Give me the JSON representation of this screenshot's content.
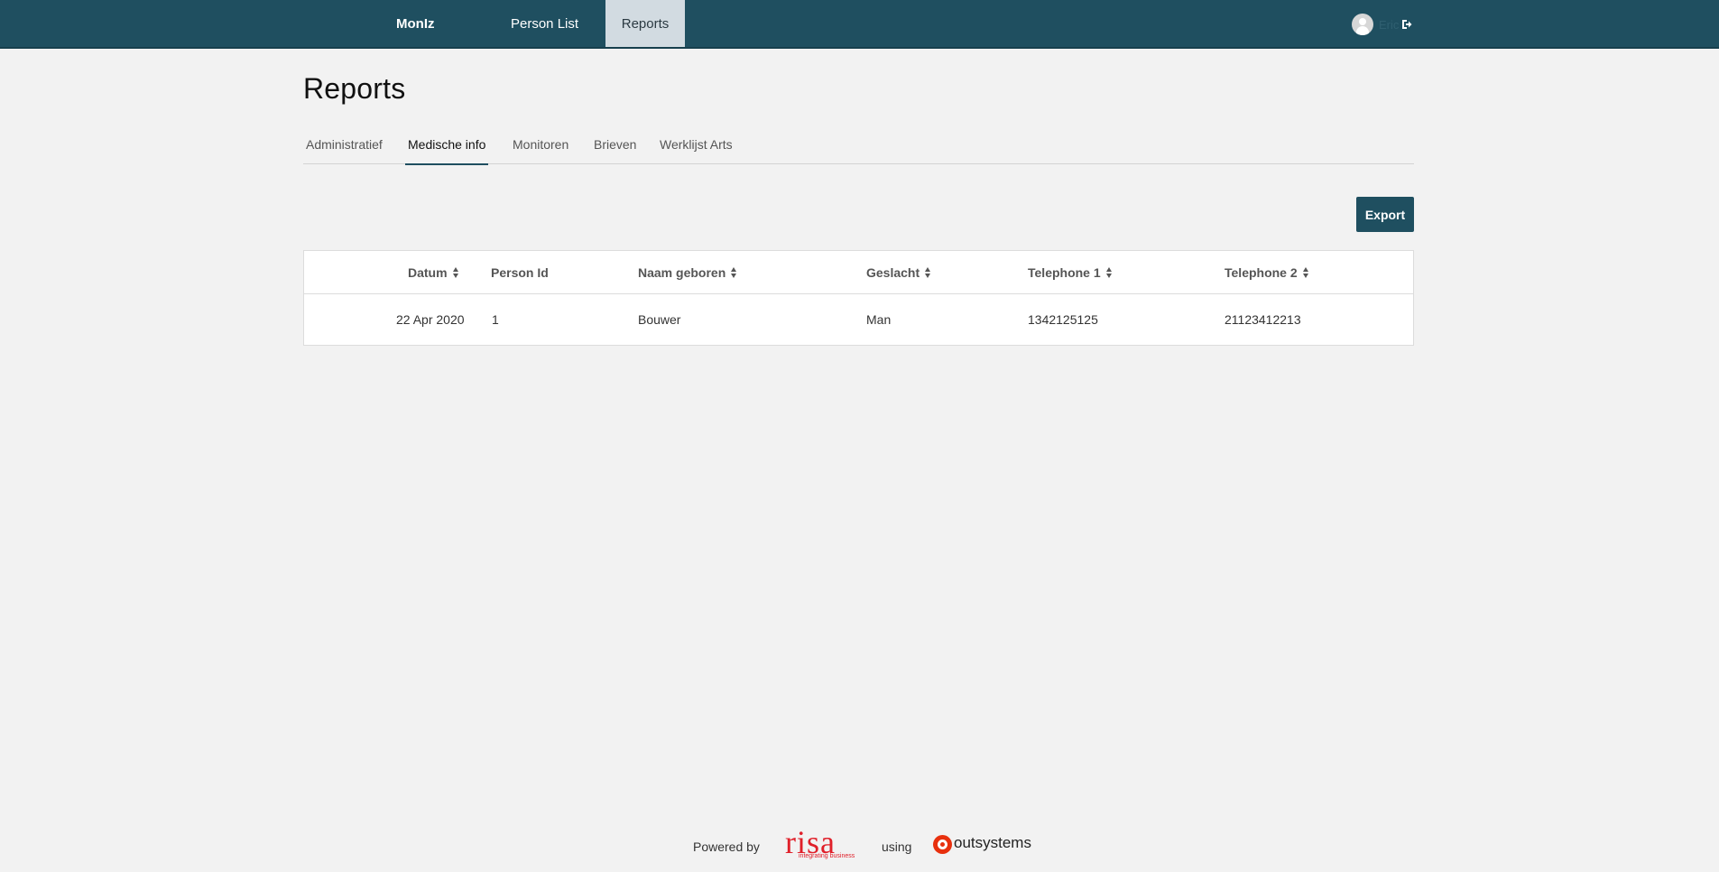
{
  "header": {
    "brand": "MonIz",
    "nav": [
      {
        "label": "Person List"
      },
      {
        "label": "Reports"
      }
    ],
    "user_name": "Eric"
  },
  "page": {
    "title": "Reports"
  },
  "tabs": [
    {
      "label": "Administratief"
    },
    {
      "label": "Medische info"
    },
    {
      "label": "Monitoren"
    },
    {
      "label": "Brieven"
    },
    {
      "label": "Werklijst Arts"
    }
  ],
  "active_tab": "Medische info",
  "toolbar": {
    "export_label": "Export"
  },
  "table": {
    "columns": [
      "Datum",
      "Person Id",
      "Naam geboren",
      "Geslacht",
      "Telephone 1",
      "Telephone 2"
    ],
    "rows": [
      [
        "22 Apr 2020",
        "1",
        "Bouwer",
        "Man",
        "1342125125",
        "21123412213"
      ]
    ]
  },
  "footer": {
    "powered_by": "Powered by",
    "risa_logo": "risa",
    "risa_tagline": "integrating business",
    "using": "using",
    "outsystems_logo": "outsystems"
  },
  "colors": {
    "header_bg": "#1f4f60",
    "active_nav_bg": "#d2dbe1",
    "risa_red": "#e0202a",
    "outsystems_red": "#e8300e"
  }
}
